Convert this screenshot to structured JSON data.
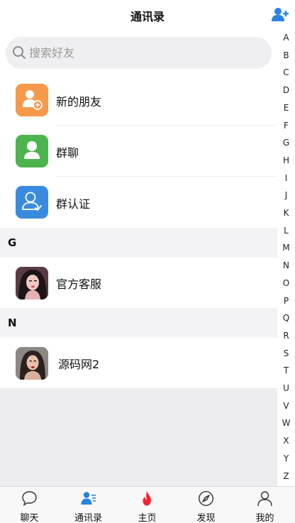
{
  "header": {
    "title": "通讯录"
  },
  "search": {
    "placeholder": "搜索好友"
  },
  "functions": [
    {
      "label": "新的朋友",
      "icon": "new-friend-icon",
      "color": "#f7994a"
    },
    {
      "label": "群聊",
      "icon": "group-chat-icon",
      "color": "#4cb44c"
    },
    {
      "label": "群认证",
      "icon": "group-verify-icon",
      "color": "#3a8be0"
    }
  ],
  "sections": [
    {
      "letter": "G",
      "contacts": [
        {
          "name": "官方客服"
        }
      ]
    },
    {
      "letter": "N",
      "contacts": [
        {
          "name": "源码网2"
        }
      ]
    }
  ],
  "index_letters": [
    "A",
    "B",
    "C",
    "D",
    "E",
    "F",
    "G",
    "H",
    "I",
    "J",
    "K",
    "L",
    "M",
    "N",
    "O",
    "P",
    "Q",
    "R",
    "S",
    "T",
    "U",
    "V",
    "W",
    "X",
    "Y",
    "Z"
  ],
  "tabbar": [
    {
      "label": "聊天",
      "icon": "chat-bubble-icon"
    },
    {
      "label": "通讯录",
      "icon": "contacts-icon",
      "active": true
    },
    {
      "label": "主页",
      "icon": "flame-icon"
    },
    {
      "label": "发现",
      "icon": "compass-icon"
    },
    {
      "label": "我的",
      "icon": "profile-icon"
    }
  ],
  "colors": {
    "accent": "#2a82e4",
    "flame": "#f5222d"
  }
}
